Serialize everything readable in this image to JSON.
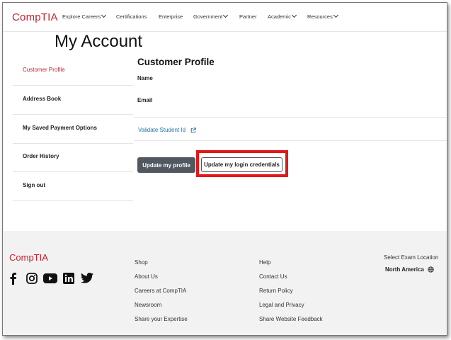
{
  "nav": {
    "logo": "CompTIA",
    "items": [
      {
        "label": "Explore Careers",
        "dropdown": true
      },
      {
        "label": "Certifications",
        "dropdown": false
      },
      {
        "label": "Enterprise",
        "dropdown": false
      },
      {
        "label": "Government",
        "dropdown": true
      },
      {
        "label": "Partner",
        "dropdown": false
      },
      {
        "label": "Academic",
        "dropdown": true
      },
      {
        "label": "Resources",
        "dropdown": true
      }
    ]
  },
  "page": {
    "title": "My Account"
  },
  "sidebar": {
    "items": [
      {
        "label": "Customer Profile",
        "active": true
      },
      {
        "label": "Address Book",
        "active": false
      },
      {
        "label": "My Saved Payment Options",
        "active": false
      },
      {
        "label": "Order History",
        "active": false
      },
      {
        "label": "Sign out",
        "active": false
      }
    ]
  },
  "profile": {
    "title": "Customer Profile",
    "name_label": "Name",
    "email_label": "Email",
    "validate_link": "Validate Student Id",
    "update_profile_button": "Update my profile",
    "update_credentials_button": "Update my login credentials"
  },
  "footer": {
    "logo": "CompTIA",
    "social_icons": [
      "facebook-icon",
      "instagram-icon",
      "youtube-icon",
      "linkedin-icon",
      "twitter-icon"
    ],
    "col1": [
      "Shop",
      "About Us",
      "Careers at CompTIA",
      "Newsroom",
      "Share your Expertise"
    ],
    "col2": [
      "Help",
      "Contact Us",
      "Return Policy",
      "Legal and Privacy",
      "Share Website Feedback"
    ],
    "location_label": "Select Exam Location",
    "location_value": "North America"
  },
  "colors": {
    "brand": "#c8202f",
    "link": "#1a73a8",
    "highlight": "#e01919",
    "dark_button": "#525860",
    "footer_bg": "#f2f2f2"
  }
}
